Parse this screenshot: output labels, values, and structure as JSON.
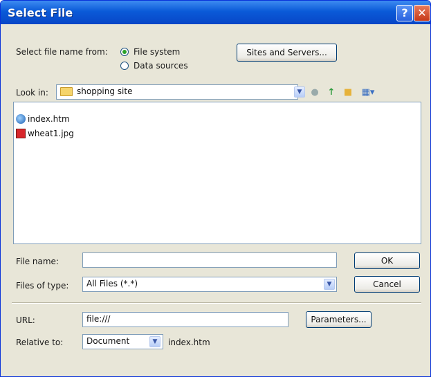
{
  "window": {
    "title": "Select File"
  },
  "titlebar_buttons": {
    "help": "?",
    "close": "✕"
  },
  "source": {
    "label": "Select file name from:",
    "options": [
      {
        "label": "File system",
        "selected": true
      },
      {
        "label": "Data sources",
        "selected": false
      }
    ],
    "sites_button": "Sites and Servers..."
  },
  "look_in": {
    "label": "Look in:",
    "value": "shopping site"
  },
  "files": [
    {
      "name": "index.htm",
      "icon": "html-document-icon"
    },
    {
      "name": "wheat1.jpg",
      "icon": "image-file-icon"
    }
  ],
  "file_name": {
    "label": "File name:",
    "value": ""
  },
  "files_of_type": {
    "label": "Files of type:",
    "value": "All Files (*.*)"
  },
  "buttons": {
    "ok": "OK",
    "cancel": "Cancel",
    "parameters": "Parameters..."
  },
  "url": {
    "label": "URL:",
    "value": "file:///"
  },
  "relative": {
    "label": "Relative to:",
    "value": "Document",
    "file": "index.htm"
  }
}
